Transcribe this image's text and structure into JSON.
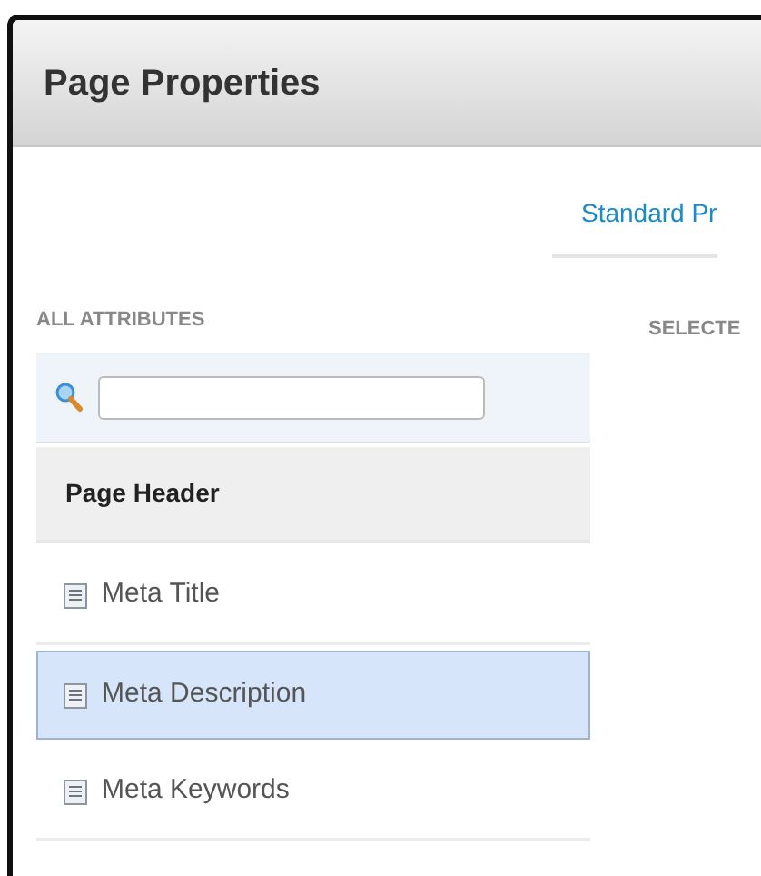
{
  "dialog": {
    "title": "Page Properties"
  },
  "tabs": [
    {
      "label": "Standard Pr",
      "selected": true
    }
  ],
  "left_panel": {
    "heading": "ALL ATTRIBUTES",
    "groups": [
      {
        "label": "Page Header",
        "items": [
          {
            "label": "Meta Title",
            "selected": false
          },
          {
            "label": "Meta Description",
            "selected": true
          },
          {
            "label": "Meta Keywords",
            "selected": false
          }
        ]
      }
    ]
  },
  "right_panel": {
    "heading": "SELECTE"
  }
}
